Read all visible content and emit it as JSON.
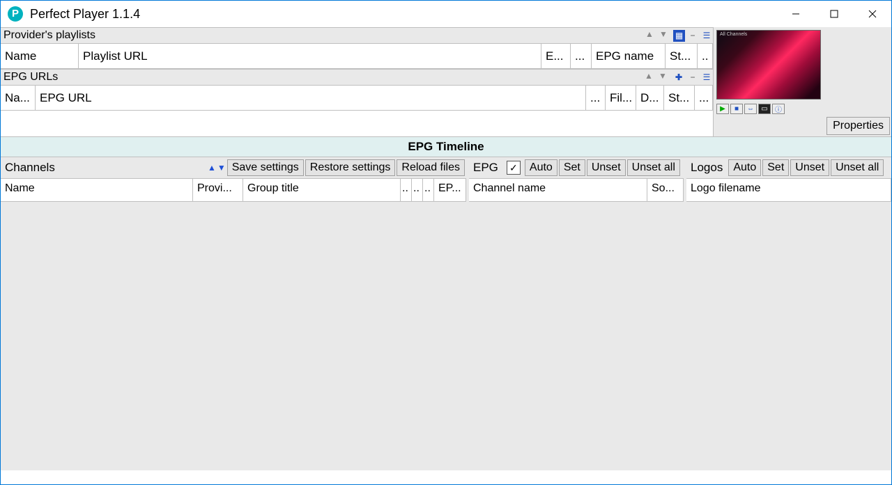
{
  "window": {
    "title": "Perfect Player 1.1.4",
    "icon_letter": "P"
  },
  "providers": {
    "label": "Provider's playlists",
    "cols": {
      "name": "Name",
      "url": "Playlist URL",
      "e": "E...",
      "dots": "...",
      "epg_name": "EPG name",
      "st": "St...",
      "last": ".."
    }
  },
  "epg_urls": {
    "label": "EPG URLs",
    "cols": {
      "name": "Na...",
      "url": "EPG URL",
      "dots": "...",
      "fil": "Fil...",
      "d": "D...",
      "st": "St...",
      "last": "..."
    }
  },
  "preview": {
    "overlay": "All Channels",
    "properties_btn": "Properties"
  },
  "timeline_header": "EPG Timeline",
  "channels_panel": {
    "label": "Channels",
    "buttons": {
      "save": "Save settings",
      "restore": "Restore settings",
      "reload": "Reload files"
    },
    "cols": {
      "name": "Name",
      "provi": "Provi...",
      "group": "Group title",
      "d1": "..",
      "d2": "..",
      "d3": "..",
      "ep": "EP..."
    }
  },
  "epg_panel": {
    "label": "EPG",
    "buttons": {
      "auto": "Auto",
      "set": "Set",
      "unset": "Unset",
      "unset_all": "Unset all"
    },
    "cols": {
      "channel_name": "Channel name",
      "so": "So..."
    }
  },
  "logos_panel": {
    "label": "Logos",
    "buttons": {
      "auto": "Auto",
      "set": "Set",
      "unset": "Unset",
      "unset_all": "Unset all"
    },
    "cols": {
      "logo_filename": "Logo filename"
    }
  }
}
